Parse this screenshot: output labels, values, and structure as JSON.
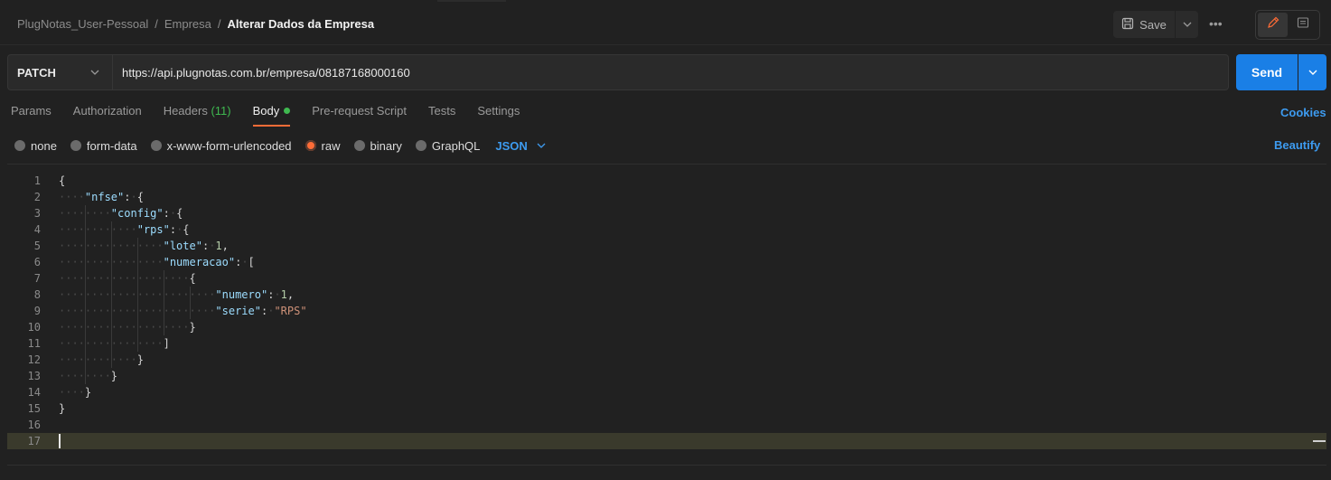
{
  "breadcrumb": {
    "workspace": "PlugNotas_User-Pessoal",
    "collection": "Empresa",
    "separator": "/",
    "request": "Alterar Dados da Empresa"
  },
  "header": {
    "save_label": "Save",
    "more_label": "•••"
  },
  "request": {
    "method": "PATCH",
    "url": "https://api.plugnotas.com.br/empresa/08187168000160",
    "send_label": "Send"
  },
  "tabs": [
    {
      "label": "Params"
    },
    {
      "label": "Authorization"
    },
    {
      "label": "Headers",
      "count": "(11)"
    },
    {
      "label": "Body",
      "active": true
    },
    {
      "label": "Pre-request Script"
    },
    {
      "label": "Tests"
    },
    {
      "label": "Settings"
    }
  ],
  "cookies_label": "Cookies",
  "body_types": [
    {
      "label": "none"
    },
    {
      "label": "form-data"
    },
    {
      "label": "x-www-form-urlencoded"
    },
    {
      "label": "raw",
      "selected": true
    },
    {
      "label": "binary"
    },
    {
      "label": "GraphQL"
    }
  ],
  "body_language": "JSON",
  "beautify_label": "Beautify",
  "colors": {
    "accent_orange": "#ff6c37",
    "link_blue": "#3d9bf0",
    "send_blue": "#1a7fe6",
    "active_green": "#3fb950"
  },
  "editor": {
    "current_line": 17,
    "lines": [
      {
        "n": "1",
        "indent": 0,
        "tokens": [
          [
            "punc",
            "{"
          ]
        ]
      },
      {
        "n": "2",
        "indent": 1,
        "tokens": [
          [
            "key",
            "\"nfse\""
          ],
          [
            "punc",
            ": {"
          ]
        ]
      },
      {
        "n": "3",
        "indent": 2,
        "tokens": [
          [
            "key",
            "\"config\""
          ],
          [
            "punc",
            ": {"
          ]
        ]
      },
      {
        "n": "4",
        "indent": 3,
        "tokens": [
          [
            "key",
            "\"rps\""
          ],
          [
            "punc",
            ": {"
          ]
        ]
      },
      {
        "n": "5",
        "indent": 4,
        "tokens": [
          [
            "key",
            "\"lote\""
          ],
          [
            "punc",
            ": "
          ],
          [
            "num",
            "1"
          ],
          [
            "punc",
            ","
          ]
        ]
      },
      {
        "n": "6",
        "indent": 4,
        "tokens": [
          [
            "key",
            "\"numeracao\""
          ],
          [
            "punc",
            ": ["
          ]
        ]
      },
      {
        "n": "7",
        "indent": 5,
        "tokens": [
          [
            "punc",
            "{"
          ]
        ]
      },
      {
        "n": "8",
        "indent": 6,
        "tokens": [
          [
            "key",
            "\"numero\""
          ],
          [
            "punc",
            ": "
          ],
          [
            "num",
            "1"
          ],
          [
            "punc",
            ","
          ]
        ]
      },
      {
        "n": "9",
        "indent": 6,
        "tokens": [
          [
            "key",
            "\"serie\""
          ],
          [
            "punc",
            ": "
          ],
          [
            "str",
            "\"RPS\""
          ]
        ]
      },
      {
        "n": "10",
        "indent": 5,
        "tokens": [
          [
            "punc",
            "}"
          ]
        ]
      },
      {
        "n": "11",
        "indent": 4,
        "tokens": [
          [
            "punc",
            "]"
          ]
        ]
      },
      {
        "n": "12",
        "indent": 3,
        "tokens": [
          [
            "punc",
            "}"
          ]
        ]
      },
      {
        "n": "13",
        "indent": 2,
        "tokens": [
          [
            "punc",
            "}"
          ]
        ]
      },
      {
        "n": "14",
        "indent": 1,
        "tokens": [
          [
            "punc",
            "}"
          ]
        ]
      },
      {
        "n": "15",
        "indent": 0,
        "tokens": [
          [
            "punc",
            "}"
          ]
        ]
      },
      {
        "n": "16",
        "indent": 0,
        "tokens": []
      },
      {
        "n": "17",
        "indent": 0,
        "tokens": []
      }
    ]
  }
}
